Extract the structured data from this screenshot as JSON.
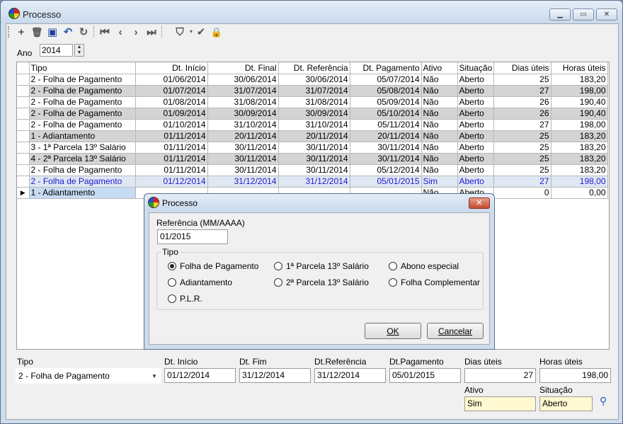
{
  "window": {
    "title": "Processo"
  },
  "filter": {
    "year_label": "Ano",
    "year_value": "2014"
  },
  "grid": {
    "columns": [
      "Tipo",
      "Dt. Início",
      "Dt. Final",
      "Dt. Referência",
      "Dt. Pagamento",
      "Ativo",
      "Situação",
      "Dias úteis",
      "Horas úteis"
    ],
    "rows": [
      [
        "2 - Folha de Pagamento",
        "01/06/2014",
        "30/06/2014",
        "30/06/2014",
        "05/07/2014",
        "Não",
        "Aberto",
        "25",
        "183,20"
      ],
      [
        "2 - Folha de Pagamento",
        "01/07/2014",
        "31/07/2014",
        "31/07/2014",
        "05/08/2014",
        "Não",
        "Aberto",
        "27",
        "198,00"
      ],
      [
        "2 - Folha de Pagamento",
        "01/08/2014",
        "31/08/2014",
        "31/08/2014",
        "05/09/2014",
        "Não",
        "Aberto",
        "26",
        "190,40"
      ],
      [
        "2 - Folha de Pagamento",
        "01/09/2014",
        "30/09/2014",
        "30/09/2014",
        "05/10/2014",
        "Não",
        "Aberto",
        "26",
        "190,40"
      ],
      [
        "2 - Folha de Pagamento",
        "01/10/2014",
        "31/10/2014",
        "31/10/2014",
        "05/11/2014",
        "Não",
        "Aberto",
        "27",
        "198,00"
      ],
      [
        "1 - Adiantamento",
        "01/11/2014",
        "20/11/2014",
        "20/11/2014",
        "20/11/2014",
        "Não",
        "Aberto",
        "25",
        "183,20"
      ],
      [
        "3 - 1ª Parcela 13º Salário",
        "01/11/2014",
        "30/11/2014",
        "30/11/2014",
        "30/11/2014",
        "Não",
        "Aberto",
        "25",
        "183,20"
      ],
      [
        "4 - 2ª Parcela 13º Salário",
        "01/11/2014",
        "30/11/2014",
        "30/11/2014",
        "30/11/2014",
        "Não",
        "Aberto",
        "25",
        "183,20"
      ],
      [
        "2 - Folha de Pagamento",
        "01/11/2014",
        "30/11/2014",
        "30/11/2014",
        "05/12/2014",
        "Não",
        "Aberto",
        "25",
        "183,20"
      ],
      [
        "2 - Folha de Pagamento",
        "01/12/2014",
        "31/12/2014",
        "31/12/2014",
        "05/01/2015",
        "Sim",
        "Aberto",
        "27",
        "198,00"
      ],
      [
        "1 - Adiantamento",
        "",
        "",
        "",
        "",
        "Não",
        "Aberto",
        "0",
        "0,00"
      ]
    ]
  },
  "dialog": {
    "title": "Processo",
    "ref_label": "Referência (MM/AAAA)",
    "ref_value": "01/2015",
    "group_label": "Tipo",
    "options": [
      "Folha de Pagamento",
      "1ª Parcela 13º Salário",
      "Abono especial",
      "Adiantamento",
      "2ª Parcela 13º Salário",
      "Folha Complementar",
      "P.L.R."
    ],
    "ok_label": "OK",
    "cancel_label": "Cancelar"
  },
  "form": {
    "tipo_label": "Tipo",
    "tipo_value": "2 - Folha de Pagamento",
    "inicio_label": "Dt. Início",
    "inicio_value": "01/12/2014",
    "fim_label": "Dt. Fim",
    "fim_value": "31/12/2014",
    "ref_label": "Dt.Referência",
    "ref_value": "31/12/2014",
    "pag_label": "Dt.Pagamento",
    "pag_value": "05/01/2015",
    "dias_label": "Dias úteis",
    "dias_value": "27",
    "horas_label": "Horas úteis",
    "horas_value": "198,00",
    "ativo_label": "Ativo",
    "ativo_value": "Sim",
    "situacao_label": "Situação",
    "situacao_value": "Aberto"
  }
}
